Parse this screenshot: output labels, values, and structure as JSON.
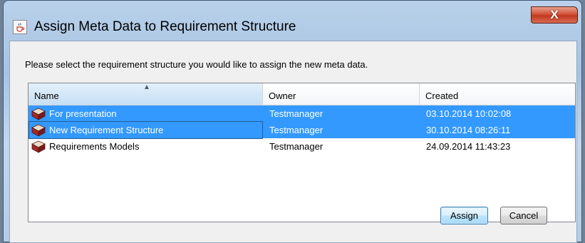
{
  "window": {
    "title": "Assign Meta Data to Requirement Structure",
    "close_glyph": "X",
    "app_icon": "java-cup-icon"
  },
  "instruction": "Please select the requirement structure you would like to assign the new meta data.",
  "table": {
    "columns": [
      "Name",
      "Owner",
      "Created"
    ],
    "sorted_column": "Name",
    "rows": [
      {
        "name": "For presentation",
        "owner": "Testmanager",
        "created": "03.10.2014 10:02:08",
        "selected": true
      },
      {
        "name": "New Requirement Structure",
        "owner": "Testmanager",
        "created": "30.10.2014 08:26:11",
        "selected": true
      },
      {
        "name": "Requirements Models",
        "owner": "Testmanager",
        "created": "24.09.2014 11:43:23",
        "selected": false
      }
    ],
    "row_icon": "book-icon"
  },
  "buttons": {
    "assign": "Assign",
    "cancel": "Cancel"
  },
  "colors": {
    "selection": "#3399ff",
    "close_button": "#c9462d"
  }
}
